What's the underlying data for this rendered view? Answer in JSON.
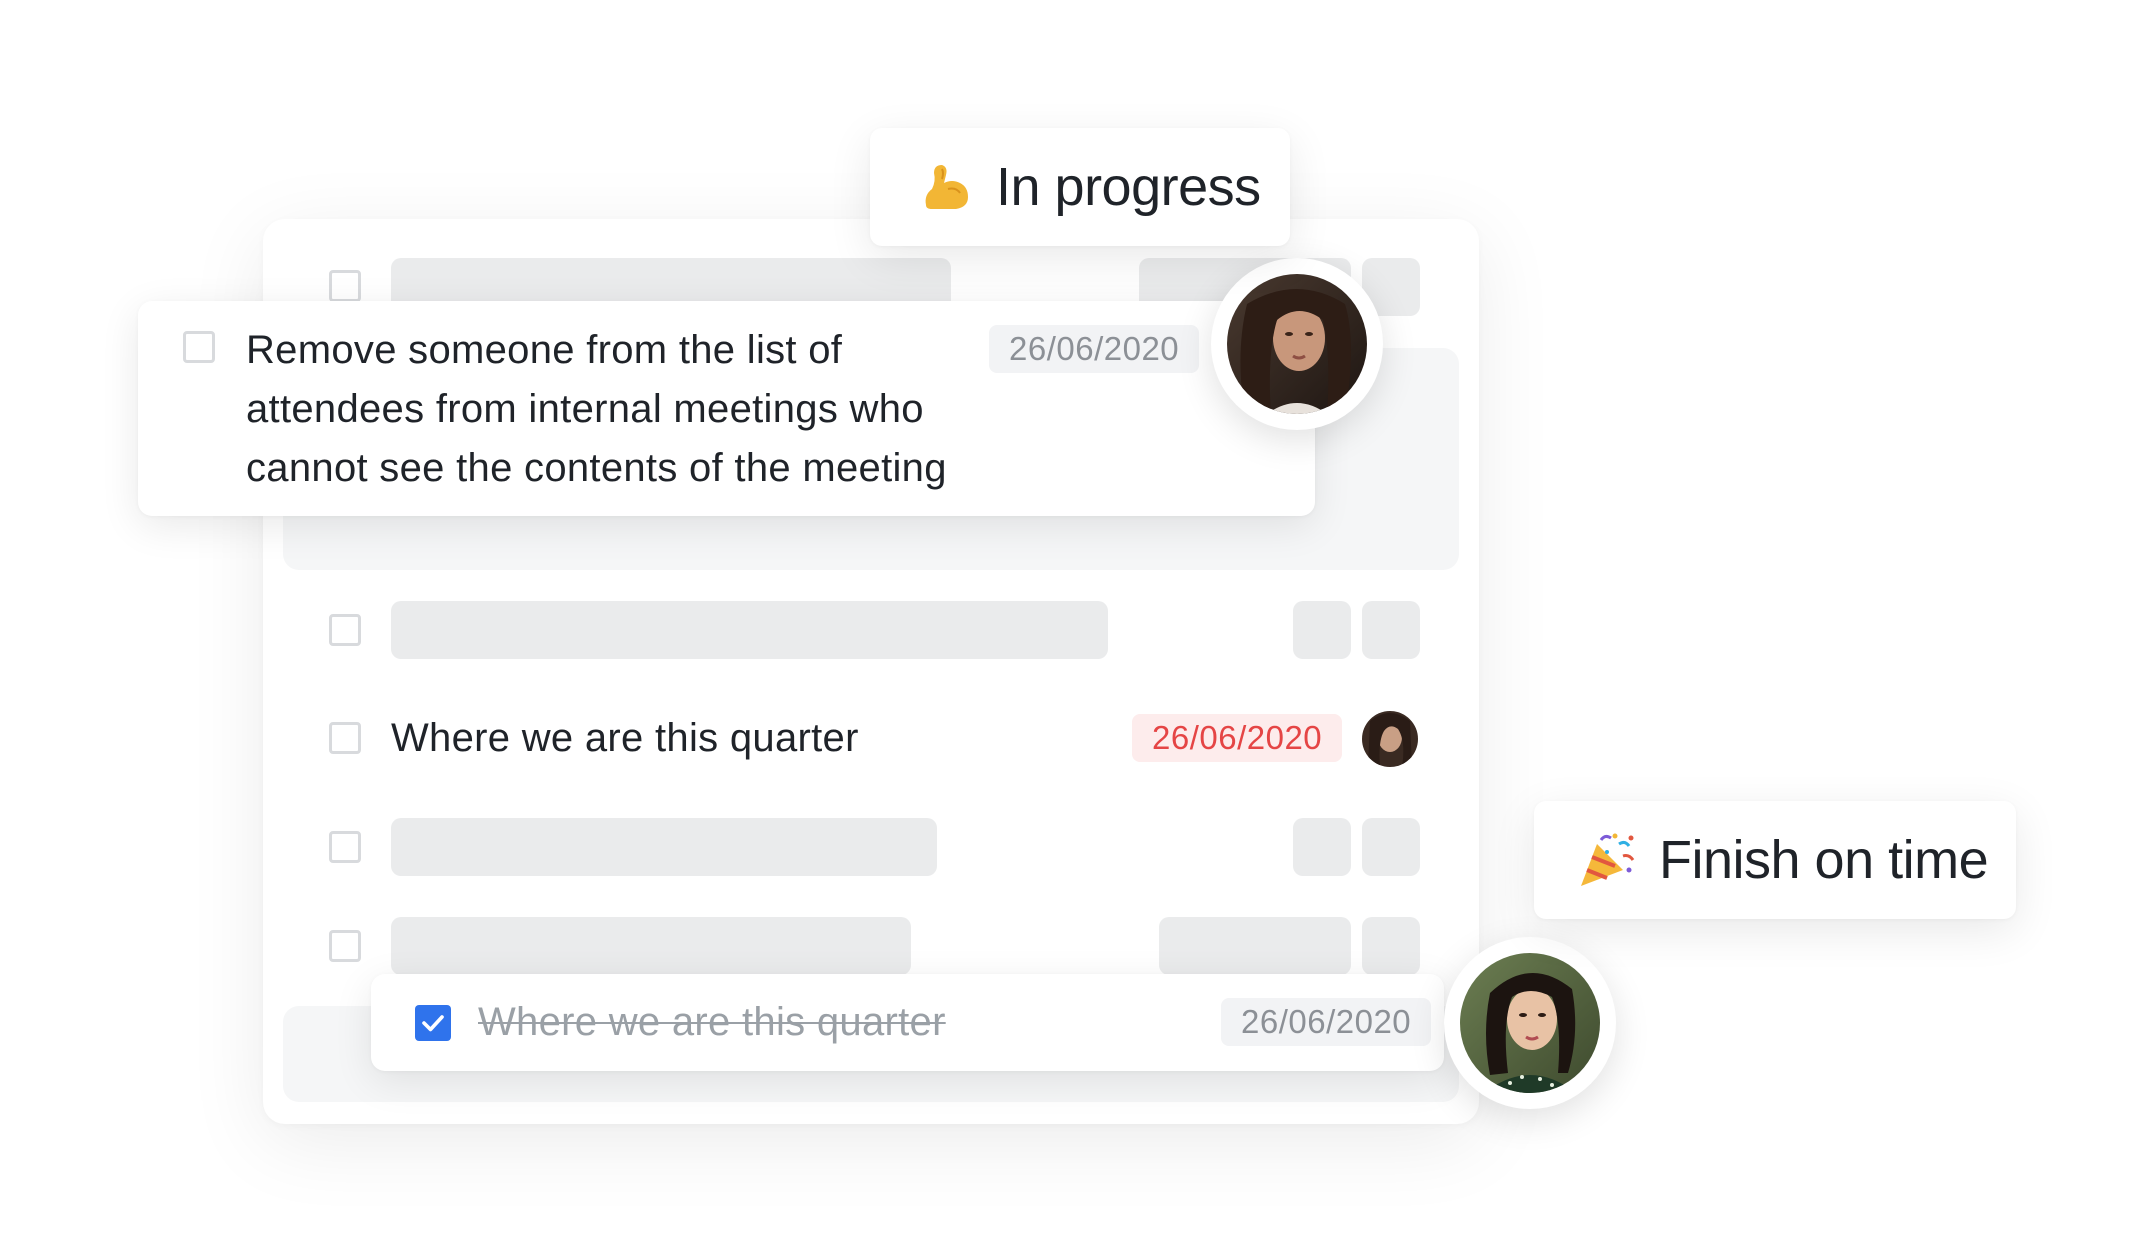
{
  "status_in_progress": {
    "emoji": "💪",
    "label": "In progress"
  },
  "status_finish": {
    "emoji": "🎉",
    "label": "Finish on time"
  },
  "task_expanded": {
    "text": "Remove someone from the list of attendees from internal meetings who cannot see the contents of the meeting",
    "line1": "Remove someone from the list of",
    "line2": "attendees from internal meetings who",
    "line3": "cannot see the contents of the meeting",
    "date": "26/06/2020",
    "checked": false
  },
  "task_quarter": {
    "text": "Where we are this quarter",
    "date": "26/06/2020",
    "date_status": "overdue",
    "checked": false
  },
  "task_done": {
    "text": "Where we are this quarter",
    "date": "26/06/2020",
    "checked": true
  },
  "colors": {
    "overdue": "#e54545",
    "checkbox_checked": "#2f73ec",
    "placeholder": "#eaebec"
  },
  "icons": {
    "check": "check-icon",
    "avatar": "avatar"
  }
}
